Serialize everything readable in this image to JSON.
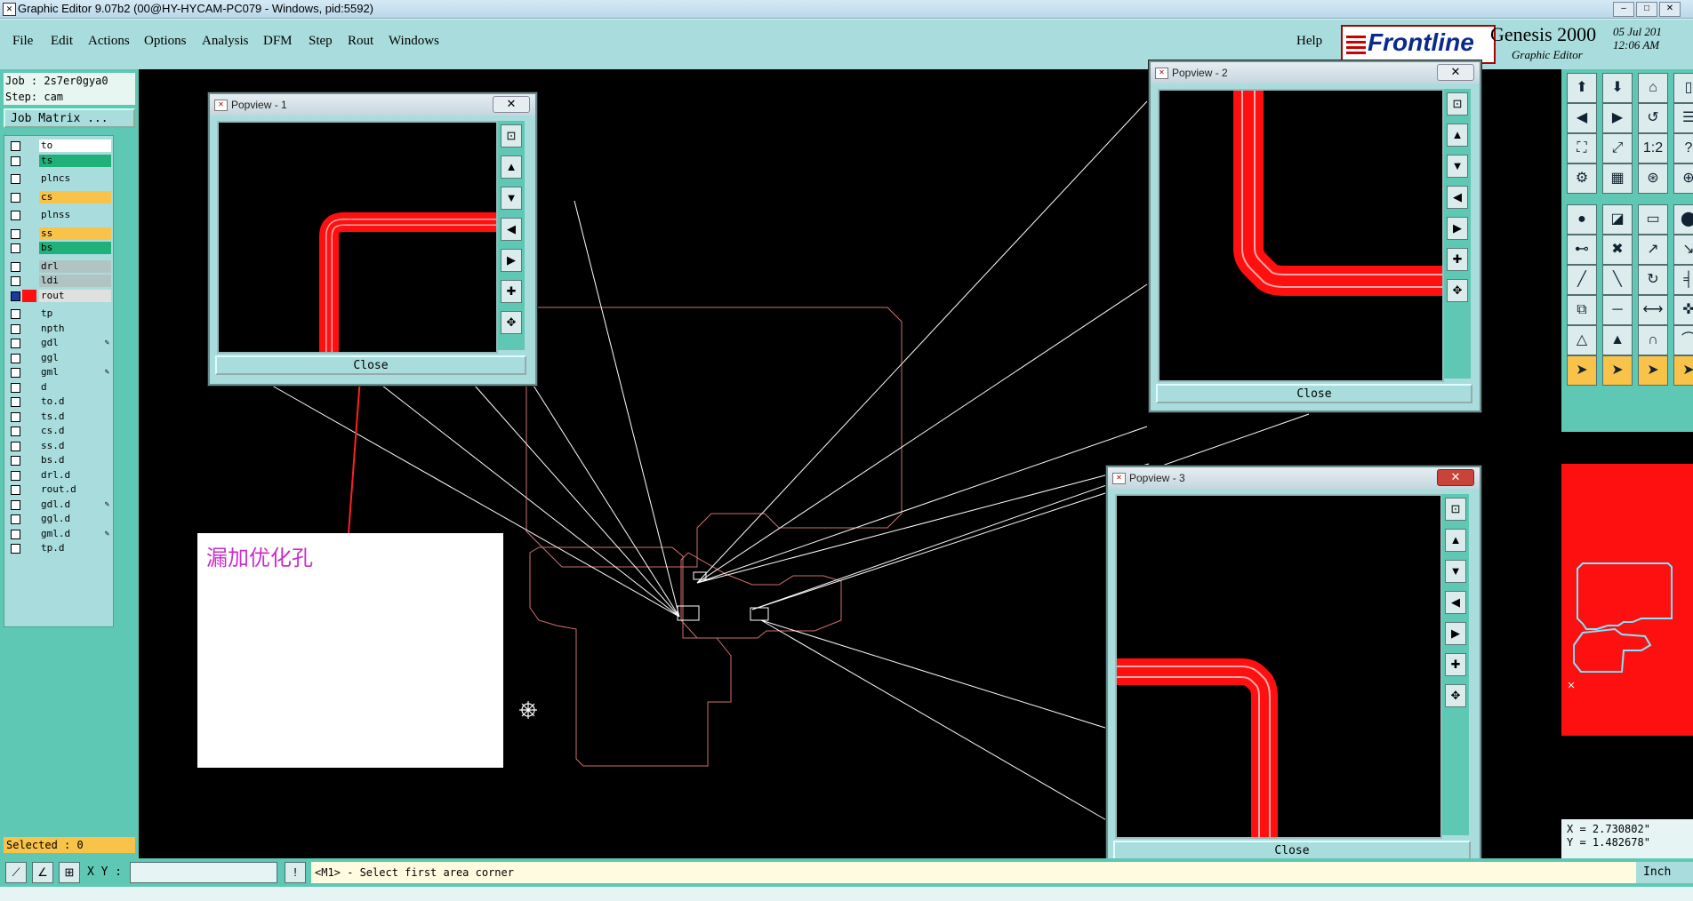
{
  "window": {
    "title": "Graphic Editor 9.07b2 (00@HY-HYCAM-PC079 - Windows, pid:5592)",
    "min": "–",
    "max": "□",
    "close": "✕"
  },
  "menubar": {
    "items": [
      "File",
      "Edit",
      "Actions",
      "Options",
      "Analysis",
      "DFM",
      "Step",
      "Rout",
      "Windows"
    ],
    "help": "Help",
    "brand": "Frontline",
    "product": "Genesis 2000",
    "product_sub": "Graphic Editor",
    "date": "05 Jul 201",
    "time": "12:06 AM"
  },
  "left": {
    "job": "Job : 2s7er0gya0",
    "step": "Step: cam",
    "job_matrix": "Job Matrix ...",
    "layers": [
      {
        "name": "to",
        "color": "#ffffff"
      },
      {
        "name": "ts",
        "color": "#20b07a"
      },
      {
        "name": "plncs",
        "color": "#a9dcdc"
      },
      {
        "name": "cs",
        "color": "#f9c34a"
      },
      {
        "name": "plnss",
        "color": "#a9dcdc"
      },
      {
        "name": "ss",
        "color": "#f9c34a"
      },
      {
        "name": "bs",
        "color": "#20b07a"
      },
      {
        "name": "drl",
        "color": "#b0c4c4"
      },
      {
        "name": "ldi",
        "color": "#b0c4c4"
      },
      {
        "name": "rout",
        "color": "#e0e0e0",
        "active": true
      },
      {
        "name": "tp",
        "color": "#a9dcdc"
      },
      {
        "name": "npth",
        "color": "#a9dcdc"
      },
      {
        "name": "gdl",
        "color": "#a9dcdc",
        "mark": "✎"
      },
      {
        "name": "ggl",
        "color": "#a9dcdc"
      },
      {
        "name": "gml",
        "color": "#a9dcdc",
        "mark": "✎"
      },
      {
        "name": "d",
        "color": "#a9dcdc"
      },
      {
        "name": "to.d",
        "color": "#a9dcdc"
      },
      {
        "name": "ts.d",
        "color": "#a9dcdc"
      },
      {
        "name": "cs.d",
        "color": "#a9dcdc"
      },
      {
        "name": "ss.d",
        "color": "#a9dcdc"
      },
      {
        "name": "bs.d",
        "color": "#a9dcdc"
      },
      {
        "name": "drl.d",
        "color": "#a9dcdc"
      },
      {
        "name": "rout.d",
        "color": "#a9dcdc"
      },
      {
        "name": "gdl.d",
        "color": "#a9dcdc",
        "mark": "✎"
      },
      {
        "name": "ggl.d",
        "color": "#a9dcdc"
      },
      {
        "name": "gml.d",
        "color": "#a9dcdc",
        "mark": "✎"
      },
      {
        "name": "tp.d",
        "color": "#a9dcdc"
      }
    ],
    "selected": "Selected : 0"
  },
  "popviews": [
    {
      "title": "Popview - 1",
      "close_label": "Close",
      "close_glyph": "✕"
    },
    {
      "title": "Popview - 2",
      "close_label": "Close",
      "close_glyph": "✕"
    },
    {
      "title": "Popview - 3",
      "close_label": "Close",
      "close_glyph": "✕"
    }
  ],
  "annotation": {
    "text": "漏加优化孔"
  },
  "coords": {
    "x": "X = 2.730802\"",
    "y": "Y = 1.482678\""
  },
  "statusbar": {
    "xy_label": "X Y :",
    "message": "<M1> - Select first area corner",
    "units": "Inch"
  }
}
